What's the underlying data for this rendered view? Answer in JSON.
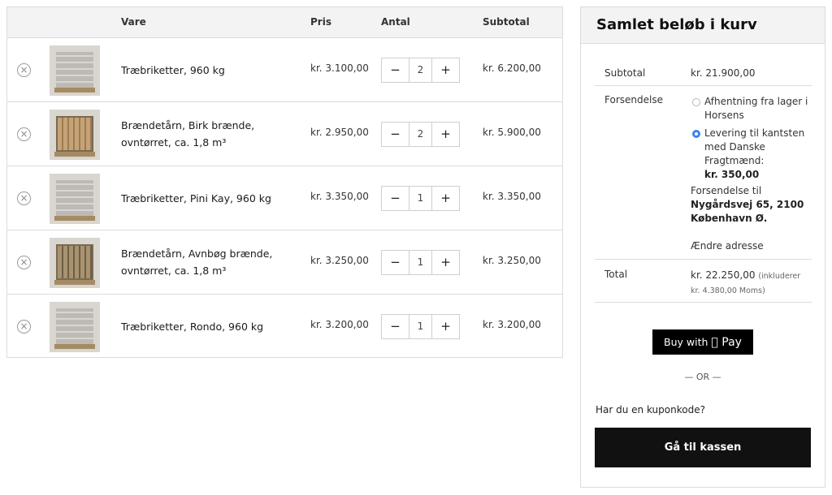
{
  "cart": {
    "columns": {
      "product": "Vare",
      "price": "Pris",
      "quantity": "Antal",
      "subtotal": "Subtotal"
    },
    "remove_symbol": "×",
    "qty_minus": "−",
    "qty_plus": "+",
    "items": [
      {
        "name": "Træbriketter, 960 kg",
        "price": "kr. 3.100,00",
        "qty": "2",
        "subtotal": "kr. 6.200,00",
        "image": "briquette-pallet"
      },
      {
        "name": "Brændetårn, Birk brænde, ovntørret, ca. 1,8 m³",
        "price": "kr. 2.950,00",
        "qty": "2",
        "subtotal": "kr. 5.900,00",
        "image": "firewood-crate"
      },
      {
        "name": "Træbriketter, Pini Kay, 960 kg",
        "price": "kr. 3.350,00",
        "qty": "1",
        "subtotal": "kr. 3.350,00",
        "image": "briquette-pallet"
      },
      {
        "name": "Brændetårn, Avnbøg brænde, ovntørret, ca. 1,8 m³",
        "price": "kr. 3.250,00",
        "qty": "1",
        "subtotal": "kr. 3.250,00",
        "image": "firewood-crate"
      },
      {
        "name": "Træbriketter, Rondo, 960 kg",
        "price": "kr. 3.200,00",
        "qty": "1",
        "subtotal": "kr. 3.200,00",
        "image": "briquette-pallet"
      }
    ]
  },
  "totals": {
    "title": "Samlet beløb i kurv",
    "subtotal_label": "Subtotal",
    "subtotal_value": "kr. 21.900,00",
    "shipping_label": "Forsendelse",
    "shipping_options": [
      {
        "label": "Afhentning fra lager i Horsens",
        "price": "",
        "checked": false
      },
      {
        "label": "Levering til kantsten med Danske Fragtmænd:",
        "price": "kr. 350,00",
        "checked": true
      }
    ],
    "shipping_to_label": "Forsendelse til",
    "shipping_address": "Nygårdsvej 65, 2100 København Ø.",
    "change_address": "Ændre adresse",
    "total_label": "Total",
    "total_value": "kr. 22.250,00",
    "total_note": "(inkluderer kr. 4.380,00 Moms)",
    "apple_pay_prefix": "Buy with",
    "apple_pay_brand": " Pay",
    "or_text": "— OR —",
    "coupon_text": "Har du en kuponkode?",
    "checkout_label": "Gå til kassen"
  },
  "colors": {
    "accent_radio": "#3b82f6",
    "button_dark": "#111111",
    "header_bg": "#f3f3f3"
  }
}
